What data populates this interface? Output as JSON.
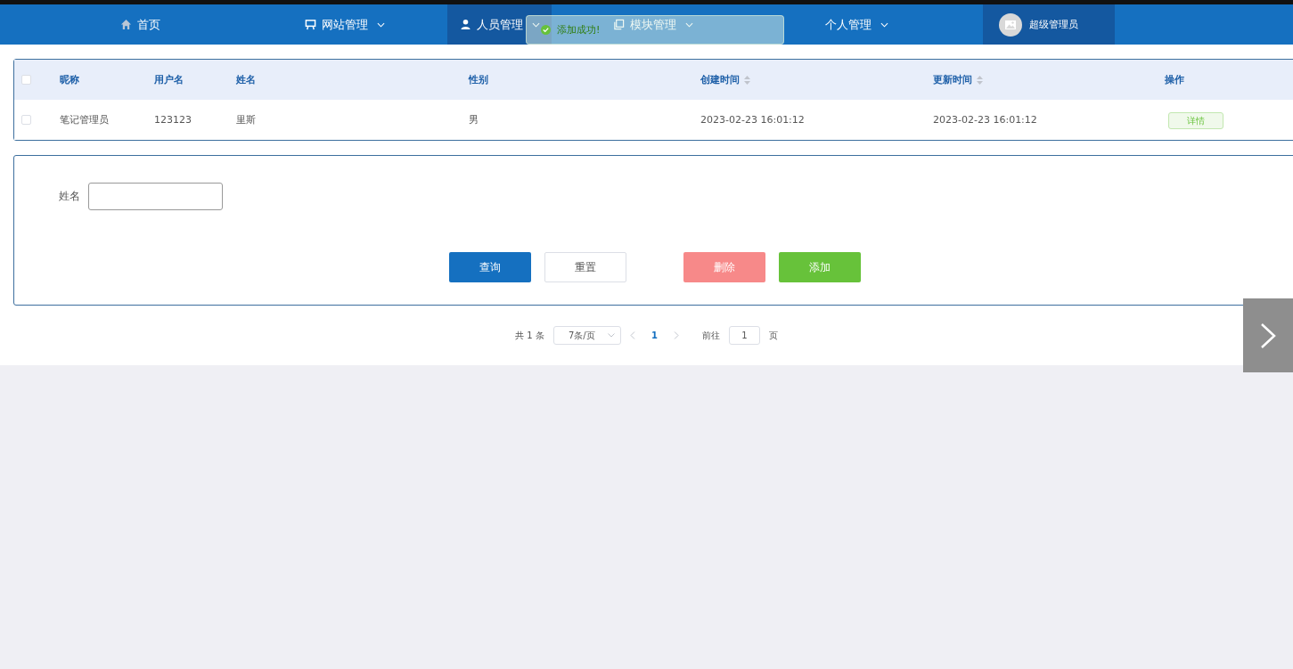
{
  "nav": {
    "items": [
      {
        "label": "首页",
        "dropdown": false,
        "selected": false
      },
      {
        "label": "网站管理",
        "dropdown": true,
        "selected": false
      },
      {
        "label": "人员管理",
        "dropdown": true,
        "selected": true
      },
      {
        "label": "模块管理",
        "dropdown": true,
        "selected": false
      },
      {
        "label": "个人管理",
        "dropdown": true,
        "selected": false
      }
    ],
    "user": {
      "name": "超级管理员"
    }
  },
  "toast": {
    "text": "添加成功!"
  },
  "table": {
    "header_checked": false,
    "columns": [
      {
        "label": "昵称",
        "sortable": false
      },
      {
        "label": "用户名",
        "sortable": false
      },
      {
        "label": "姓名",
        "sortable": false
      },
      {
        "label": "性别",
        "sortable": false
      },
      {
        "label": "创建时间",
        "sortable": true
      },
      {
        "label": "更新时间",
        "sortable": true
      },
      {
        "label": "操作",
        "sortable": false
      }
    ],
    "rows": [
      {
        "checked": false,
        "cells": [
          "笔记管理员",
          "123123",
          "里斯",
          "男",
          "2023-02-23 16:01:12",
          "2023-02-23 16:01:12"
        ],
        "action": "详情"
      }
    ]
  },
  "search_form": {
    "fields": [
      {
        "label": "姓名"
      }
    ],
    "buttons": [
      {
        "label": "查询",
        "kind": "primary"
      },
      {
        "label": "重置",
        "kind": "default"
      },
      {
        "label": "删除",
        "kind": "danger"
      },
      {
        "label": "添加",
        "kind": "success"
      }
    ]
  },
  "pagination": {
    "total": "共 1 条",
    "page_size": "7条/页",
    "pages": [
      {
        "label": "1",
        "selected": true
      }
    ],
    "jump_prefix": "前往",
    "jump_value": "1",
    "jump_suffix": "页"
  }
}
